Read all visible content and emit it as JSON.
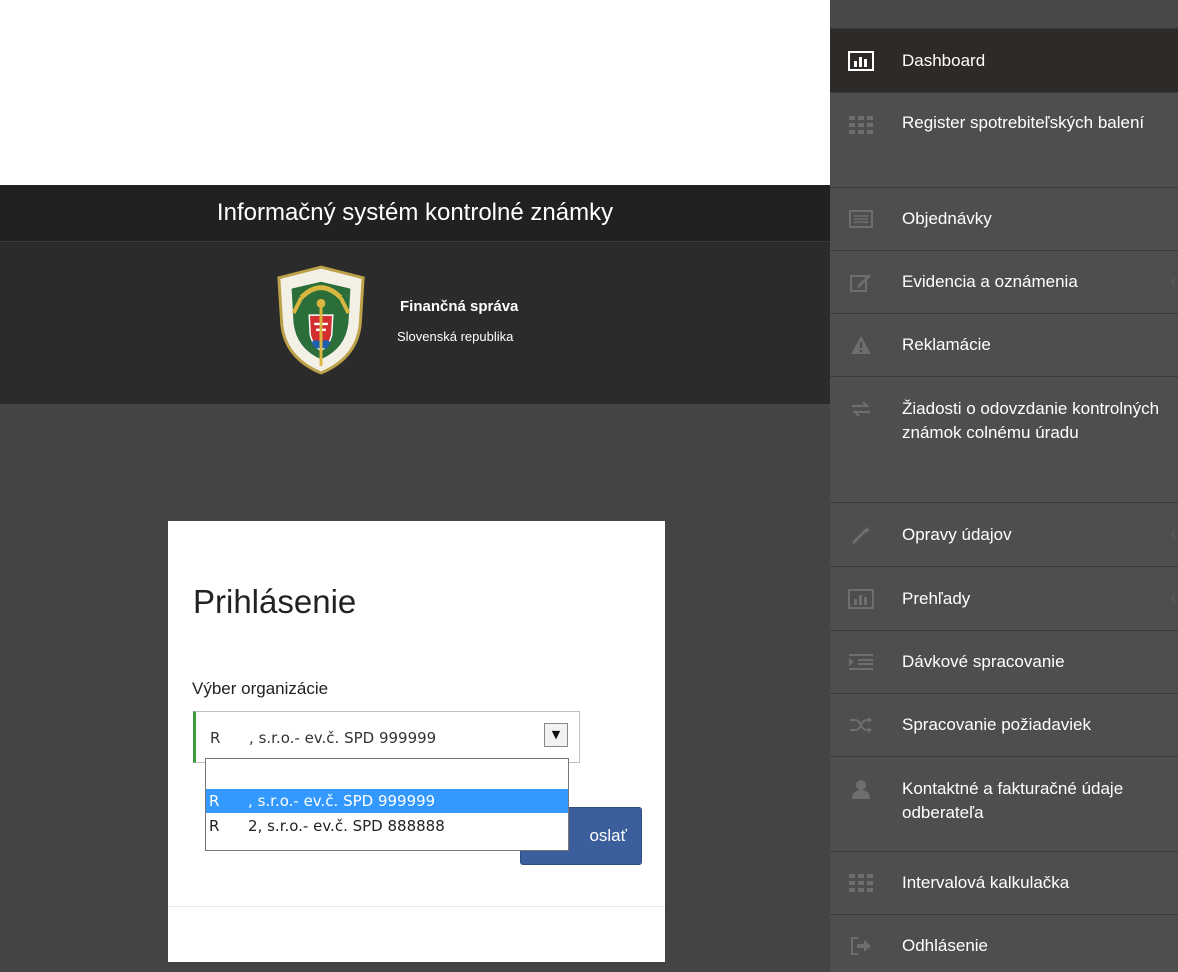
{
  "app": {
    "title": "Informačný systém kontrolné známky"
  },
  "organization": {
    "name": "Finančná správa",
    "country": "Slovenská republika"
  },
  "login": {
    "title": "Prihlásenie",
    "org_label": "Výber organizácie",
    "selected_value": "R      , s.r.o.- ev.č. SPD 999999",
    "options": [
      "",
      "R      , s.r.o.- ev.č. SPD 999999",
      "R      2, s.r.o.- ev.č. SPD 888888"
    ],
    "submit_label": "oslať"
  },
  "sidebar": {
    "items": [
      {
        "label": "Dashboard",
        "icon": "bar-chart-icon",
        "active": true
      },
      {
        "label": "Register spotrebiteľských balení",
        "icon": "grid-icon"
      },
      {
        "label": "Objednávky",
        "icon": "list-icon"
      },
      {
        "label": "Evidencia a oznámenia",
        "icon": "edit-icon",
        "has_submenu": true
      },
      {
        "label": "Reklamácie",
        "icon": "warning-icon"
      },
      {
        "label": "Žiadosti o odovzdanie kontrolných známok colnému úradu",
        "icon": "transfer-icon"
      },
      {
        "label": "Opravy údajov",
        "icon": "magic-wand-icon",
        "has_submenu": true
      },
      {
        "label": "Prehľady",
        "icon": "bar-chart-icon",
        "has_submenu": true
      },
      {
        "label": "Dávkové spracovanie",
        "icon": "indent-list-icon"
      },
      {
        "label": "Spracovanie požiadaviek",
        "icon": "shuffle-icon"
      },
      {
        "label": "Kontaktné a fakturačné údaje odberateľa",
        "icon": "user-icon"
      },
      {
        "label": "Intervalová kalkulačka",
        "icon": "grid-icon"
      },
      {
        "label": "Odhlásenie",
        "icon": "logout-icon"
      }
    ]
  }
}
